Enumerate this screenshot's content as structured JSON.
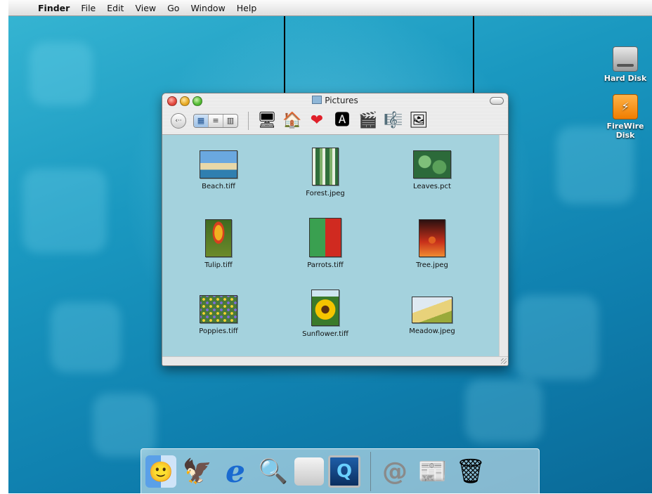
{
  "menubar": {
    "apple_glyph": "",
    "app_name": "Finder",
    "items": [
      "File",
      "Edit",
      "View",
      "Go",
      "Window",
      "Help"
    ]
  },
  "desktop_icons": [
    {
      "label": "Hard Disk",
      "icon": "hard-disk-icon"
    },
    {
      "label": "FireWire Disk",
      "icon": "firewire-disk-icon"
    }
  ],
  "window": {
    "title": "Pictures",
    "toolbar": {
      "back_glyph": "‹··",
      "views": [
        {
          "name": "icon-view",
          "glyph": "▦",
          "active": true
        },
        {
          "name": "list-view",
          "glyph": "≡",
          "active": false
        },
        {
          "name": "column-view",
          "glyph": "▥",
          "active": false
        }
      ],
      "shortcuts": [
        {
          "name": "computer-icon",
          "glyph": "🖥"
        },
        {
          "name": "home-icon",
          "glyph": "🏠"
        },
        {
          "name": "favorites-icon",
          "glyph": "❤"
        },
        {
          "name": "applications-icon",
          "glyph": "🅰"
        },
        {
          "name": "movies-icon",
          "glyph": "🎬"
        },
        {
          "name": "music-icon",
          "glyph": "🎼"
        },
        {
          "name": "pictures-icon",
          "glyph": "🖼"
        }
      ]
    },
    "files": [
      {
        "name": "Beach.tiff",
        "thumb": "beach"
      },
      {
        "name": "Forest.jpeg",
        "thumb": "forest"
      },
      {
        "name": "Leaves.pct",
        "thumb": "leaves"
      },
      {
        "name": "Tulip.tiff",
        "thumb": "tulip"
      },
      {
        "name": "Parrots.tiff",
        "thumb": "parrots"
      },
      {
        "name": "Tree.jpeg",
        "thumb": "tree"
      },
      {
        "name": "Poppies.tiff",
        "thumb": "poppies"
      },
      {
        "name": "Sunflower.tiff",
        "thumb": "sunflower"
      },
      {
        "name": "Meadow.jpeg",
        "thumb": "meadow"
      }
    ]
  },
  "dock": {
    "left": [
      {
        "name": "finder-dock-icon",
        "glyph": "🙂"
      },
      {
        "name": "mail-dock-icon",
        "glyph": "🦅"
      },
      {
        "name": "internet-explorer-dock-icon",
        "glyph": "e"
      },
      {
        "name": "sherlock-dock-icon",
        "glyph": "🔍"
      },
      {
        "name": "system-preferences-dock-icon",
        "glyph": ""
      },
      {
        "name": "quicktime-dock-icon",
        "glyph": "Q"
      }
    ],
    "right": [
      {
        "name": "internet-location-dock-icon",
        "glyph": "@"
      },
      {
        "name": "document-dock-icon",
        "glyph": "📰"
      },
      {
        "name": "trash-dock-icon",
        "glyph": "🗑"
      }
    ]
  }
}
